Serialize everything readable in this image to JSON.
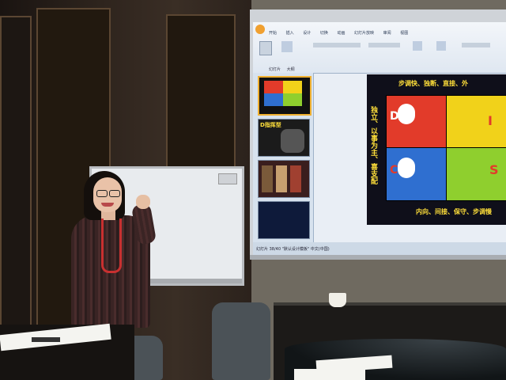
{
  "ppt": {
    "menu": [
      "开始",
      "插入",
      "设计",
      "切换",
      "动画",
      "幻灯片放映",
      "审阅",
      "视图"
    ],
    "panel_tabs": [
      "幻灯片",
      "大纲"
    ],
    "status_text": "幻灯片 38/40  \"默认设计模板\"  中文(中国)"
  },
  "slide": {
    "title": "步调快、独断、直接、外",
    "footer": "内向、间接、保守、步调慢",
    "left_vertical": "独立、以事为主、喜支配",
    "letters": [
      "D",
      "I",
      "C",
      "S"
    ]
  },
  "thumb_label": "D指挥型",
  "colors": {
    "wall": "#6f6a60",
    "slide_bg": "#0f0f1a",
    "accent_yellow": "#ffdf3a",
    "quad_red": "#e23b2a",
    "quad_yellow": "#f1d21a",
    "quad_blue": "#2f6fd0",
    "quad_green": "#8fcf2e"
  }
}
